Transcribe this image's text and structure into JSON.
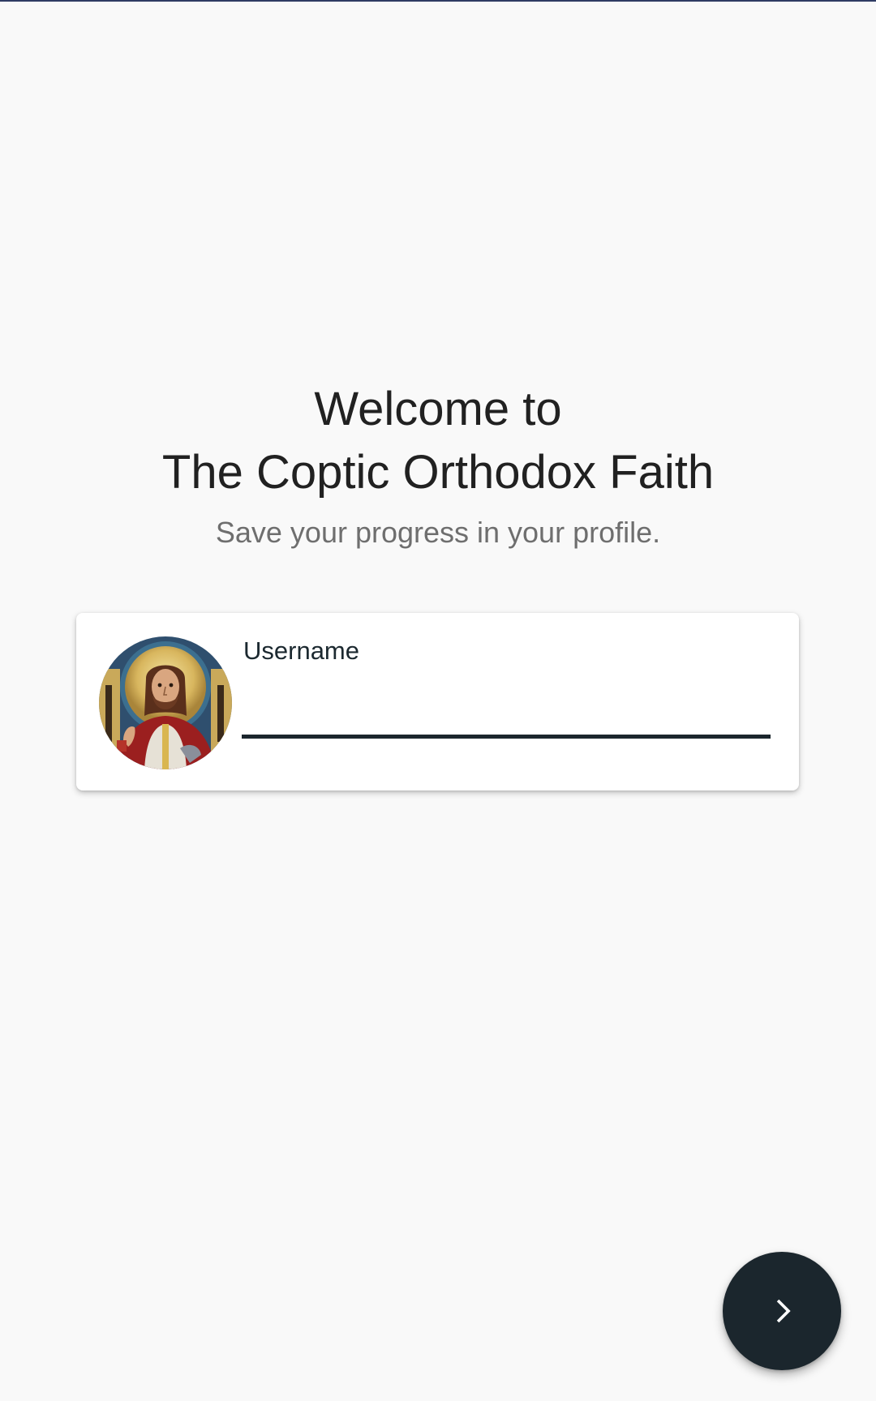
{
  "welcome": {
    "line1": "Welcome to",
    "line2": "The Coptic Orthodox Faith",
    "subtitle": "Save your progress in your profile."
  },
  "profile_card": {
    "avatar_icon": "christ-pantocrator-icon",
    "username_label": "Username",
    "username_value": "",
    "username_placeholder": ""
  },
  "fab": {
    "icon": "chevron-right-icon"
  },
  "colors": {
    "background": "#f9f9f9",
    "primary_dark": "#1b262d",
    "title_text": "#212121",
    "subtitle_text": "#6e6e6e",
    "card": "#ffffff"
  }
}
